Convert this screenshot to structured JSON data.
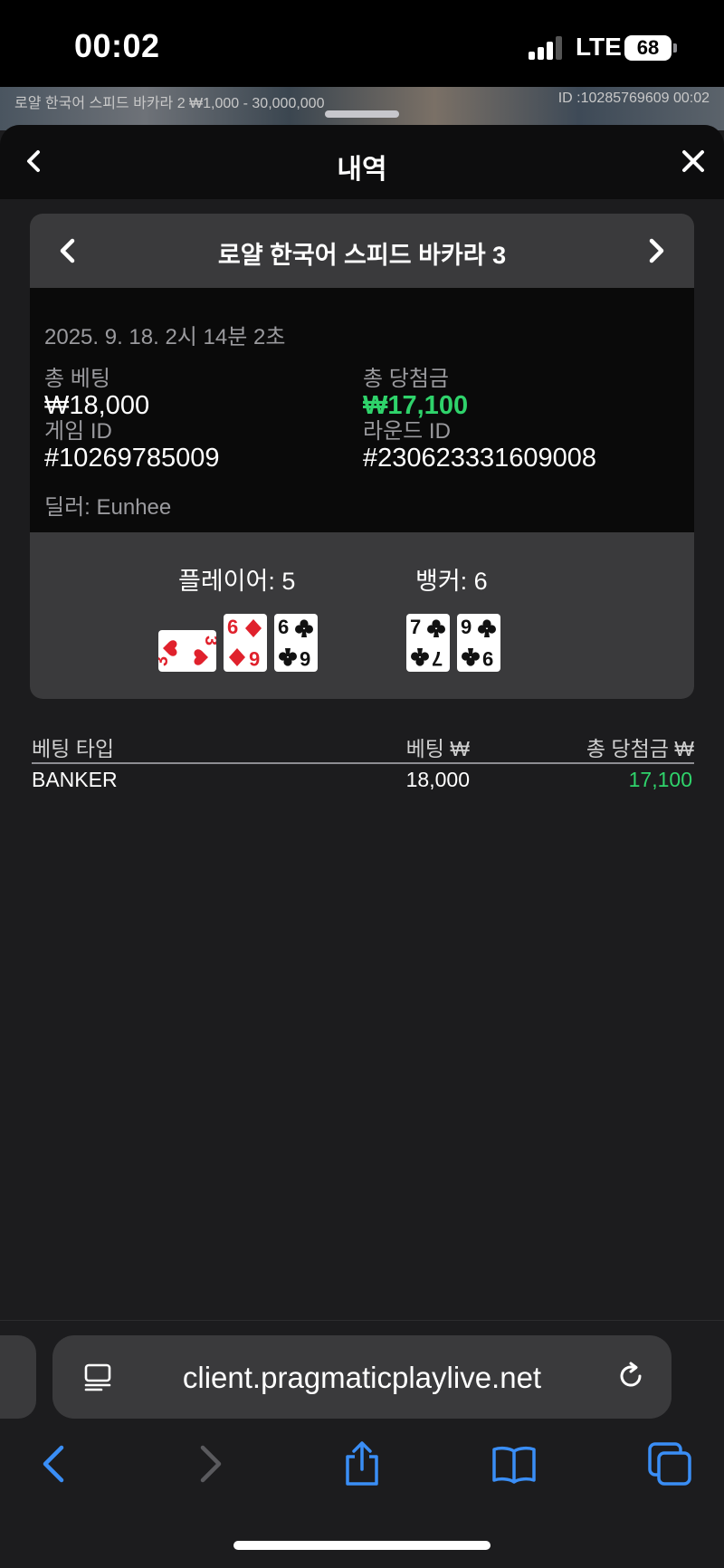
{
  "status_bar": {
    "time": "00:02",
    "network": "LTE",
    "battery": "68"
  },
  "background": {
    "table_title": "로얄 한국어 스피드 바카라 2 ₩1,000 - 30,000,000",
    "id_text": "ID :10285769609 00:02"
  },
  "sheet": {
    "title": "내역"
  },
  "game": {
    "title": "로얄 한국어 스피드 바카라 3",
    "date": "2025. 9. 18. 2시 14분 2초",
    "total_bet_label": "총 베팅",
    "total_bet_value": "₩18,000",
    "total_win_label": "총 당첨금",
    "total_win_value": "₩17,100",
    "game_id_label": "게임 ID",
    "game_id_value": "#10269785009",
    "round_id_label": "라운드 ID",
    "round_id_value": "#230623331609008",
    "dealer": "딜러: Eunhee"
  },
  "hands": {
    "player_label": "플레이어: 5",
    "banker_label": "뱅커: 6",
    "player_cards": [
      {
        "rank": "3",
        "suit": "heart",
        "color": "#e0212c",
        "orientation": "sideways"
      },
      {
        "rank": "6",
        "suit": "diamond",
        "color": "#e0212c"
      },
      {
        "rank": "6",
        "suit": "club",
        "color": "#111111"
      }
    ],
    "banker_cards": [
      {
        "rank": "7",
        "suit": "club",
        "color": "#111111"
      },
      {
        "rank": "9",
        "suit": "club",
        "color": "#111111"
      }
    ]
  },
  "bets_table": {
    "headers": [
      "베팅 타입",
      "베팅 ₩",
      "총 당첨금 ₩"
    ],
    "rows": [
      {
        "type": "BANKER",
        "bet": "18,000",
        "win": "17,100"
      }
    ]
  },
  "browser": {
    "url": "client.pragmaticplaylive.net"
  },
  "colors": {
    "win_green": "#2fd36b",
    "accent_blue": "#3a8ef6"
  }
}
